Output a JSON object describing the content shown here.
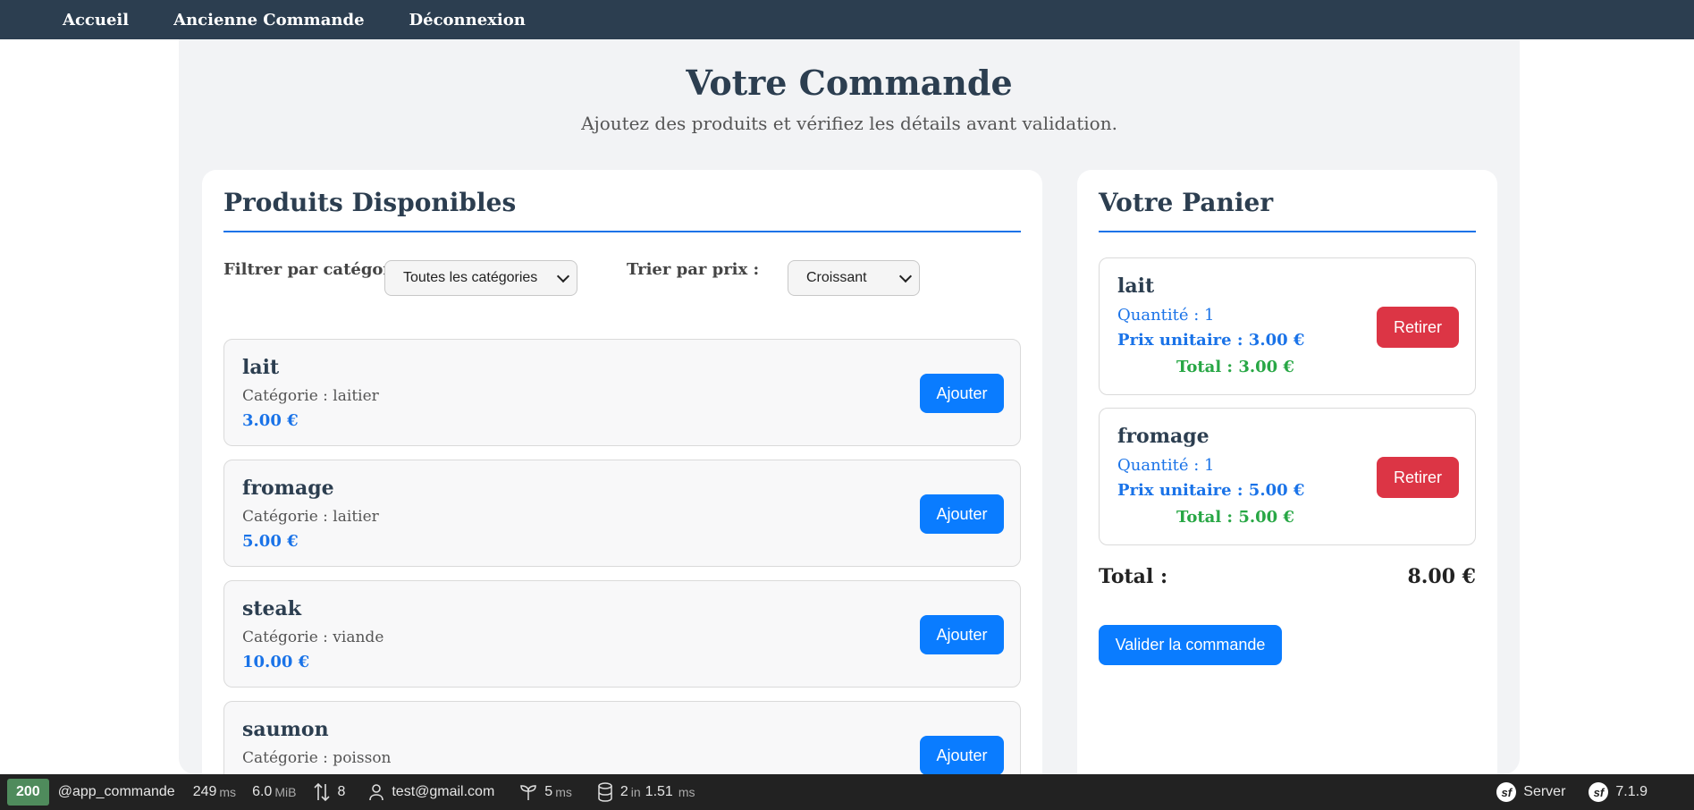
{
  "nav": {
    "items": [
      "Accueil",
      "Ancienne Commande",
      "Déconnexion"
    ]
  },
  "header": {
    "title": "Votre Commande",
    "subtitle": "Ajoutez des produits et vérifiez les détails avant validation."
  },
  "products": {
    "title": "Produits Disponibles",
    "filter_label": "Filtrer par catégorie :",
    "filter_value": "Toutes les catégories",
    "sort_label": "Trier par prix :",
    "sort_value": "Croissant",
    "add_label": "Ajouter",
    "items": [
      {
        "name": "lait",
        "category": "Catégorie : laitier",
        "price": "3.00 €"
      },
      {
        "name": "fromage",
        "category": "Catégorie : laitier",
        "price": "5.00 €"
      },
      {
        "name": "steak",
        "category": "Catégorie : viande",
        "price": "10.00 €"
      },
      {
        "name": "saumon",
        "category": "Catégorie : poisson",
        "price": ""
      }
    ]
  },
  "cart": {
    "title": "Votre Panier",
    "remove_label": "Retirer",
    "items": [
      {
        "name": "lait",
        "quantity": "Quantité : 1",
        "unit_price": "Prix unitaire : 3.00 €",
        "total": "Total : 3.00 €"
      },
      {
        "name": "fromage",
        "quantity": "Quantité : 1",
        "unit_price": "Prix unitaire : 5.00 €",
        "total": "Total : 5.00 €"
      }
    ],
    "total_label": "Total :",
    "total_value": "8.00 €",
    "validate_label": "Valider la commande"
  },
  "toolbar": {
    "status": "200",
    "route": "@app_commande",
    "time": "249",
    "time_unit": "ms",
    "memory": "6.0",
    "memory_unit": "MiB",
    "requests": "8",
    "user": "test@gmail.com",
    "cache_time": "5",
    "cache_unit": "ms",
    "db_queries": "2",
    "db_in": "in",
    "db_time": "1.51",
    "db_unit": "ms",
    "server_label": "Server",
    "version": "7.1.9",
    "sf_icon": "symfony-icon"
  },
  "colors": {
    "nav_bg": "#2c3e50",
    "accent": "#0a7cff",
    "danger": "#dc3545",
    "success": "#28a745"
  }
}
